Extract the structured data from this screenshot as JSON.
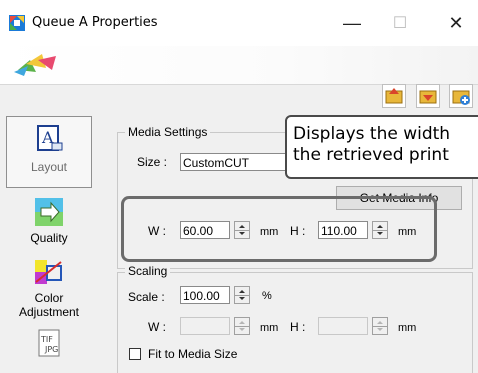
{
  "window": {
    "title": "Queue A Properties",
    "minimize_glyph": "—",
    "maximize_glyph": "☐",
    "close_glyph": "✕"
  },
  "toolbar_icons": [
    "folder-up-icon",
    "folder-down-icon",
    "folder-add-icon"
  ],
  "sidebar": {
    "items": [
      {
        "label": "Layout",
        "icon": "layout-icon",
        "selected": true
      },
      {
        "label": "Quality",
        "icon": "quality-icon",
        "selected": false
      },
      {
        "label": "Color\nAdjustment",
        "label_line1": "Color",
        "label_line2": "Adjustment",
        "icon": "color-adjustment-icon",
        "selected": false
      },
      {
        "label": "",
        "icon": "tiff-icon",
        "selected": false
      }
    ]
  },
  "media_settings": {
    "title": "Media Settings",
    "size_label": "Size :",
    "size_value": "CustomCUT",
    "get_media_button": "Get Media Info",
    "width_label": "W :",
    "width_value": "60.00",
    "width_unit": "mm",
    "height_label": "H :",
    "height_value": "110.00",
    "height_unit": "mm"
  },
  "scaling": {
    "title": "Scaling",
    "scale_label": "Scale :",
    "scale_value": "100.00",
    "scale_unit": "%",
    "width_label": "W :",
    "width_value": "",
    "width_unit": "mm",
    "height_label": "H :",
    "height_value": "",
    "height_unit": "mm",
    "fit_label": "Fit to Media Size",
    "fit_checked": false
  },
  "tooltip": {
    "line1": "Displays the width",
    "line2": "the retrieved print"
  }
}
